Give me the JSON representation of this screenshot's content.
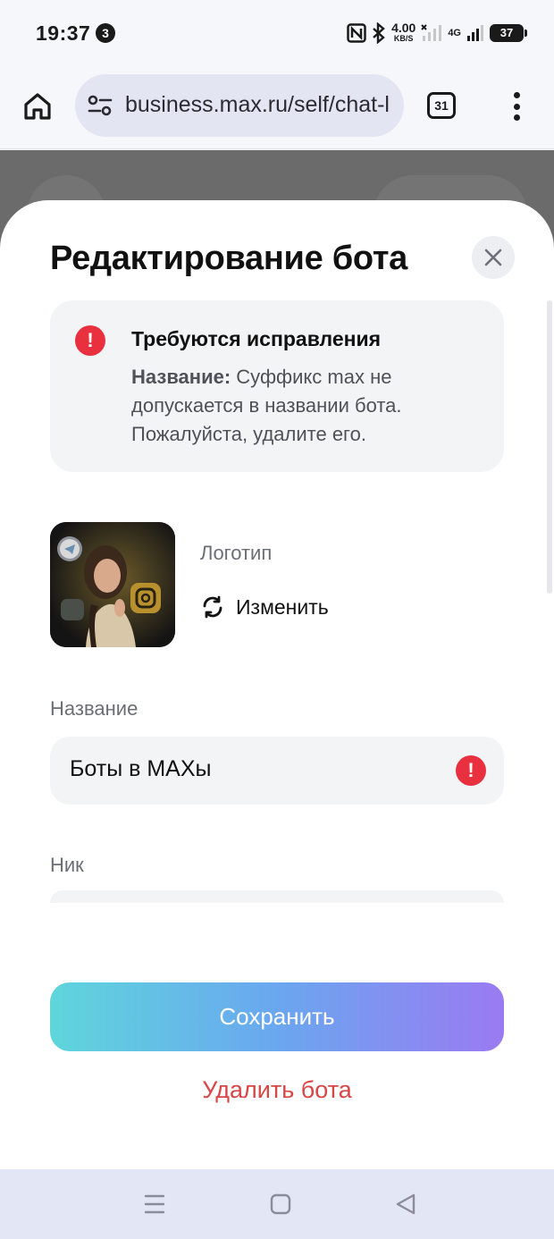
{
  "status_bar": {
    "time": "19:37",
    "notification_count": "3",
    "speed_value": "4.00",
    "speed_unit": "KB/S",
    "network": "4G",
    "battery": "37"
  },
  "browser": {
    "url": "business.max.ru/self/chat-l",
    "tab_count": "31"
  },
  "sheet": {
    "title": "Редактирование бота",
    "alert": {
      "title": "Требуются исправления",
      "field_prefix": "Название:",
      "message": "Суффикс max не допускается в названии бота. Пожалуйста, удалите его."
    },
    "logo": {
      "label": "Логотип",
      "change_label": "Изменить"
    },
    "name_field": {
      "label": "Название",
      "value": "Боты в МАХы"
    },
    "nick_field": {
      "label": "Ник"
    },
    "save_label": "Сохранить",
    "delete_label": "Удалить бота"
  },
  "colors": {
    "error": "#e8303f",
    "delete": "#d94646",
    "save_gradient_start": "#5ed6dc",
    "save_gradient_end": "#9a7af2"
  },
  "icons": {
    "home": "home-icon",
    "site_settings": "tune-icon",
    "more": "more-vertical-icon",
    "close": "close-icon",
    "alert": "error-icon",
    "change": "refresh-icon"
  }
}
